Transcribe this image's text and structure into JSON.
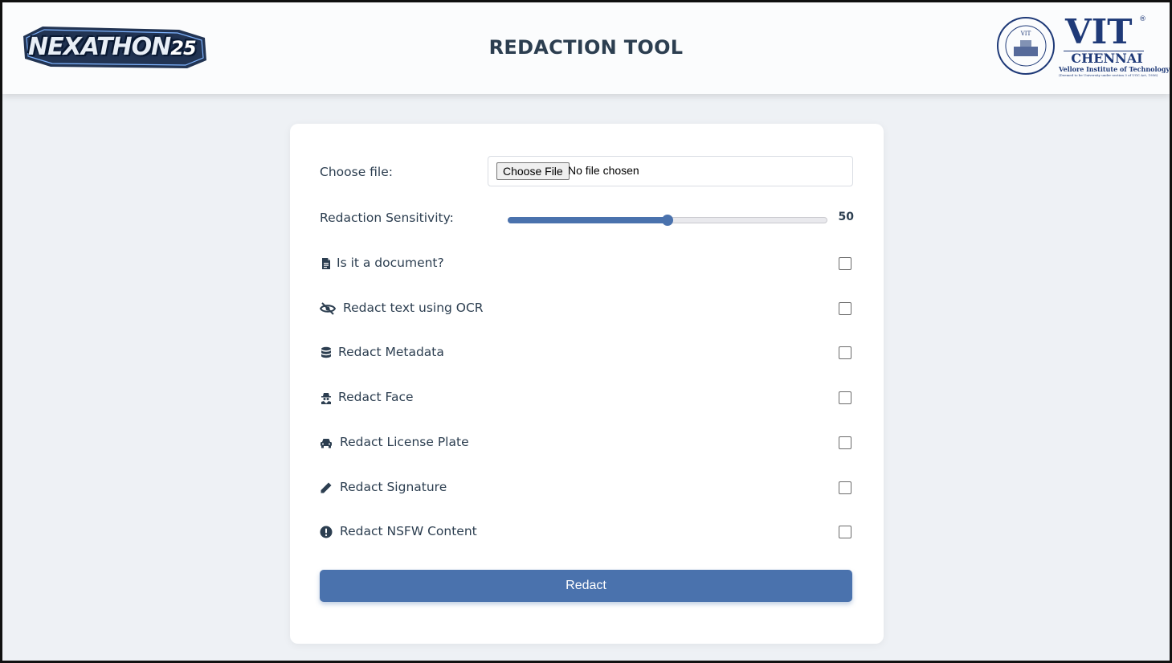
{
  "header": {
    "brand": "NEXATHON",
    "brand_year": "25",
    "title": "REDACTION TOOL",
    "institution": {
      "name": "VIT",
      "registered": "®",
      "city": "CHENNAI",
      "full_name": "Vellore Institute of Technology",
      "note": "(Deemed to be University under section 3 of UGC Act, 1956)",
      "seal_text": "VIT"
    }
  },
  "form": {
    "file": {
      "label": "Choose file:",
      "button": "Choose File",
      "status": "No file chosen"
    },
    "sensitivity": {
      "label": "Redaction Sensitivity:",
      "value": "50",
      "fraction": 0.5
    },
    "options": [
      {
        "label": "Is it a document?",
        "icon": "file-icon",
        "checked": false
      },
      {
        "label": "Redact text using OCR",
        "icon": "eye-slash-icon",
        "checked": false
      },
      {
        "label": "Redact Metadata",
        "icon": "database-icon",
        "checked": false
      },
      {
        "label": "Redact Face",
        "icon": "user-secret-icon",
        "checked": false
      },
      {
        "label": "Redact License Plate",
        "icon": "car-icon",
        "checked": false
      },
      {
        "label": "Redact Signature",
        "icon": "pen-icon",
        "checked": false
      },
      {
        "label": "Redact NSFW Content",
        "icon": "exclamation-circle-icon",
        "checked": false
      }
    ],
    "submit": "Redact"
  },
  "colors": {
    "accent": "#4a72ad",
    "text": "#2c3e50",
    "background": "#eef1f5"
  }
}
